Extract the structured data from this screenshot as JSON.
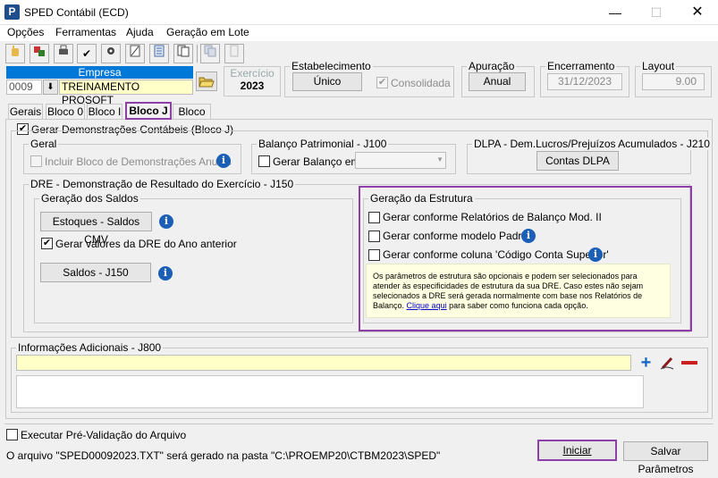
{
  "window": {
    "title": "SPED Contábil (ECD)",
    "icon_letter": "P"
  },
  "menu": [
    "Opções",
    "Ferramentas",
    "Ajuda",
    "Geração em Lote"
  ],
  "empresa": {
    "label": "Empresa",
    "code": "0009",
    "name": "TREINAMENTO PROSOFT"
  },
  "exercicio": {
    "label": "Exercício",
    "value": "2023"
  },
  "estabelecimento": {
    "label": "Estabelecimento",
    "value": "Único",
    "consolidada": "Consolidada"
  },
  "apuracao": {
    "label": "Apuração",
    "value": "Anual"
  },
  "encerramento": {
    "label": "Encerramento",
    "value": "31/12/2023"
  },
  "layout": {
    "label": "Layout",
    "value": "9.00"
  },
  "tabs": [
    "Gerais",
    "Bloco 0",
    "Bloco I",
    "Bloco J",
    "Bloco K"
  ],
  "bloco_j": {
    "main_check": "Gerar Demonstrações Contábeis (Bloco J)",
    "geral": {
      "label": "Geral",
      "incluir": "Incluir Bloco de Demonstrações Anuais"
    },
    "balanco": {
      "label": "Balanço Patrimonial - J100",
      "gerar": "Gerar Balanço em"
    },
    "dlpa": {
      "label": "DLPA - Dem.Lucros/Prejuízos Acumulados - J210",
      "button": "Contas DLPA"
    },
    "dre": {
      "label": "DRE - Demonstração de Resultado do Exercício - J150",
      "saldos": {
        "label": "Geração dos Saldos",
        "estoques_btn": "Estoques - Saldos CMV",
        "gerar_valores": "Gerar valores da DRE do Ano anterior",
        "saldos_btn": "Saldos - J150"
      },
      "estrutura": {
        "label": "Geração da Estrutura",
        "opt1": "Gerar conforme Relatórios de Balanço Mod. II",
        "opt2": "Gerar conforme modelo Padrão",
        "opt3": "Gerar conforme coluna 'Código Conta Superior'",
        "note_l1": "Os parâmetros de estrutura são opcionais e podem ser selecionados para",
        "note_l2": "atender às especificidades de estrutura da sua DRE. Caso estes não sejam",
        "note_l3": "selecionados a DRE será gerada normalmente com base nos Relatórios de",
        "note_l4a": "Balanço.",
        "note_link": "Clique aqui",
        "note_l4b": "para saber como funciona cada opção."
      }
    },
    "info_adic": {
      "label": "Informações Adicionais - J800"
    }
  },
  "footer": {
    "prevalidacao": "Executar Pré-Validação do Arquivo",
    "status": "O arquivo \"SPED00092023.TXT\" será gerado na pasta \"C:\\PROEMP20\\CTBM2023\\SPED\"",
    "iniciar": "Iniciar",
    "salvar": "Salvar Parâmetros"
  },
  "colors": {
    "highlight": "#8e3fa8",
    "empresa_bar": "#0078d7",
    "note_bg": "#ffffe1",
    "field_yellow": "#ffffc8"
  },
  "icons": [
    "open-folder-icon",
    "info-icon",
    "plus-icon",
    "edit-icon",
    "minus-icon"
  ]
}
